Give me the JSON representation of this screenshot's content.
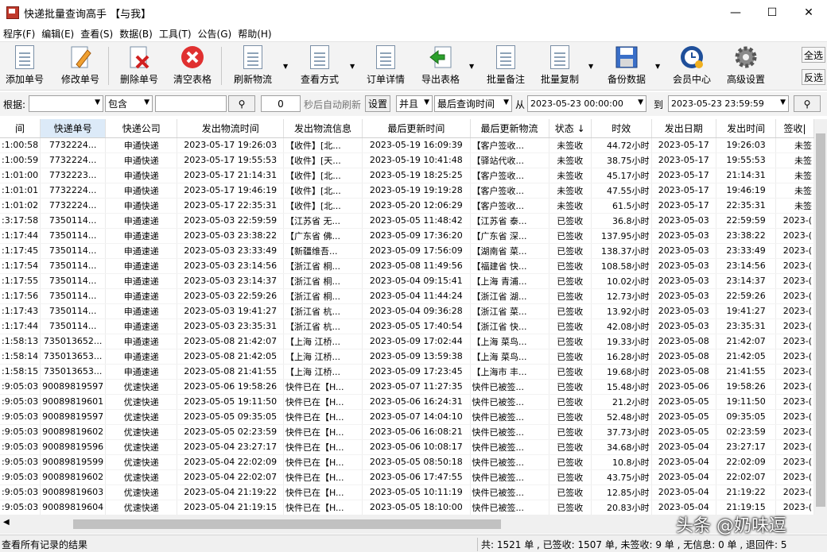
{
  "window": {
    "title": "快递批量查询高手 【与我】",
    "minimize": "—",
    "maximize": "☐",
    "close": "✕"
  },
  "menu": [
    "程序(F)",
    "编辑(E)",
    "查看(S)",
    "数据(B)",
    "工具(T)",
    "公告(G)",
    "帮助(H)"
  ],
  "toolbar": {
    "add": "添加单号",
    "edit": "修改单号",
    "delete": "删除单号",
    "clear": "清空表格",
    "refresh": "刷新物流",
    "view": "查看方式",
    "detail": "订单详情",
    "export": "导出表格",
    "batch_note": "批量备注",
    "batch_copy": "批量复制",
    "backup": "备份数据",
    "member": "会员中心",
    "advanced": "高级设置",
    "select_all": "全选",
    "invert": "反选"
  },
  "filter": {
    "based_on_label": "根据:",
    "based_on_value": "",
    "mode": "包含",
    "keyword": "",
    "seconds": "0",
    "auto_refresh_label": "秒后自动刷新",
    "settings": "设置",
    "logic": "并且",
    "time_field": "最后查询时间",
    "from_label": "从",
    "from": "2023-05-23 00:00:00",
    "to_label": "到",
    "to": "2023-05-23 23:59:59"
  },
  "columns": [
    "间",
    "快递单号",
    "快递公司",
    "发出物流时间",
    "发出物流信息",
    "最后更新时间",
    "最后更新物流",
    "状态 ↓",
    "时效",
    "发出日期",
    "发出时间",
    "签收|"
  ],
  "rows": [
    [
      ":1:00:58",
      "7732224...",
      "申通快递",
      "2023-05-17 19:26:03",
      "【收件】[北...",
      "2023-05-19 16:09:39",
      "【客户签收...",
      "未签收",
      "44.72小时",
      "2023-05-17",
      "19:26:03",
      "未签"
    ],
    [
      ":1:00:59",
      "7732224...",
      "申通快递",
      "2023-05-17 19:55:53",
      "【收件】[天...",
      "2023-05-19 10:41:48",
      "【驿站代收...",
      "未签收",
      "38.75小时",
      "2023-05-17",
      "19:55:53",
      "未签"
    ],
    [
      ":1:01:00",
      "7732223...",
      "申通快递",
      "2023-05-17 21:14:31",
      "【收件】[北...",
      "2023-05-19 18:25:25",
      "【客户签收...",
      "未签收",
      "45.17小时",
      "2023-05-17",
      "21:14:31",
      "未签"
    ],
    [
      ":1:01:01",
      "7732224...",
      "申通快递",
      "2023-05-17 19:46:19",
      "【收件】[北...",
      "2023-05-19 19:19:28",
      "【客户签收...",
      "未签收",
      "47.55小时",
      "2023-05-17",
      "19:46:19",
      "未签"
    ],
    [
      ":1:01:02",
      "7732224...",
      "申通快递",
      "2023-05-17 22:35:31",
      "【收件】[北...",
      "2023-05-20 12:06:29",
      "【客户签收...",
      "未签收",
      "61.5小时",
      "2023-05-17",
      "22:35:31",
      "未签"
    ],
    [
      ":3:17:58",
      "7350114...",
      "申通速递",
      "2023-05-03 22:59:59",
      "【江苏省 无...",
      "2023-05-05 11:48:42",
      "【江苏省 泰...",
      "已签收",
      "36.8小时",
      "2023-05-03",
      "22:59:59",
      "2023-("
    ],
    [
      ":1:17:44",
      "7350114...",
      "申通速递",
      "2023-05-03 23:38:22",
      "【广东省 佛...",
      "2023-05-09 17:36:20",
      "【广东省 深...",
      "已签收",
      "137.95小时",
      "2023-05-03",
      "23:38:22",
      "2023-("
    ],
    [
      ":1:17:45",
      "7350114...",
      "申通速递",
      "2023-05-03 23:33:49",
      "【新疆维吾...",
      "2023-05-09 17:56:09",
      "【湖南省 菜...",
      "已签收",
      "138.37小时",
      "2023-05-03",
      "23:33:49",
      "2023-("
    ],
    [
      ":1:17:54",
      "7350114...",
      "申通速递",
      "2023-05-03 23:14:56",
      "【浙江省 桐...",
      "2023-05-08 11:49:56",
      "【福建省 快...",
      "已签收",
      "108.58小时",
      "2023-05-03",
      "23:14:56",
      "2023-("
    ],
    [
      ":1:17:55",
      "7350114...",
      "申通速递",
      "2023-05-03 23:14:37",
      "【浙江省 桐...",
      "2023-05-04 09:15:41",
      "【上海 青浦...",
      "已签收",
      "10.02小时",
      "2023-05-03",
      "23:14:37",
      "2023-("
    ],
    [
      ":1:17:56",
      "7350114...",
      "申通速递",
      "2023-05-03 22:59:26",
      "【浙江省 桐...",
      "2023-05-04 11:44:24",
      "【浙江省 湖...",
      "已签收",
      "12.73小时",
      "2023-05-03",
      "22:59:26",
      "2023-("
    ],
    [
      ":1:17:43",
      "7350114...",
      "申通速递",
      "2023-05-03 19:41:27",
      "【浙江省 杭...",
      "2023-05-04 09:36:28",
      "【浙江省 菜...",
      "已签收",
      "13.92小时",
      "2023-05-03",
      "19:41:27",
      "2023-("
    ],
    [
      ":1:17:44",
      "7350114...",
      "申通速递",
      "2023-05-03 23:35:31",
      "【浙江省 杭...",
      "2023-05-05 17:40:54",
      "【浙江省 快...",
      "已签收",
      "42.08小时",
      "2023-05-03",
      "23:35:31",
      "2023-("
    ],
    [
      ":1:58:13",
      "735013652...",
      "申通速递",
      "2023-05-08 21:42:07",
      "【上海 江桥...",
      "2023-05-09 17:02:44",
      "【上海 菜鸟...",
      "已签收",
      "19.33小时",
      "2023-05-08",
      "21:42:07",
      "2023-("
    ],
    [
      ":1:58:14",
      "735013653...",
      "申通速递",
      "2023-05-08 21:42:05",
      "【上海 江桥...",
      "2023-05-09 13:59:38",
      "【上海 菜鸟...",
      "已签收",
      "16.28小时",
      "2023-05-08",
      "21:42:05",
      "2023-("
    ],
    [
      ":1:58:15",
      "735013653...",
      "申通速递",
      "2023-05-08 21:41:55",
      "【上海 江桥...",
      "2023-05-09 17:23:45",
      "【上海市 丰...",
      "已签收",
      "19.68小时",
      "2023-05-08",
      "21:41:55",
      "2023-("
    ],
    [
      ":9:05:03",
      "90089819597",
      "优速快递",
      "2023-05-06 19:58:26",
      "快件已在【H...",
      "2023-05-07 11:27:35",
      "快件已被签...",
      "已签收",
      "15.48小时",
      "2023-05-06",
      "19:58:26",
      "2023-("
    ],
    [
      ":9:05:03",
      "90089819601",
      "优速快递",
      "2023-05-05 19:11:50",
      "快件已在【H...",
      "2023-05-06 16:24:31",
      "快件已被签...",
      "已签收",
      "21.2小时",
      "2023-05-05",
      "19:11:50",
      "2023-("
    ],
    [
      ":9:05:03",
      "90089819597",
      "优速快递",
      "2023-05-05 09:35:05",
      "快件已在【H...",
      "2023-05-07 14:04:10",
      "快件已被签...",
      "已签收",
      "52.48小时",
      "2023-05-05",
      "09:35:05",
      "2023-("
    ],
    [
      ":9:05:03",
      "90089819602",
      "优速快递",
      "2023-05-05 02:23:59",
      "快件已在【H...",
      "2023-05-06 16:08:21",
      "快件已被签...",
      "已签收",
      "37.73小时",
      "2023-05-05",
      "02:23:59",
      "2023-("
    ],
    [
      ":9:05:03",
      "90089819596",
      "优速快递",
      "2023-05-04 23:27:17",
      "快件已在【H...",
      "2023-05-06 10:08:17",
      "快件已被签...",
      "已签收",
      "34.68小时",
      "2023-05-04",
      "23:27:17",
      "2023-("
    ],
    [
      ":9:05:03",
      "90089819599",
      "优速快递",
      "2023-05-04 22:02:09",
      "快件已在【H...",
      "2023-05-05 08:50:18",
      "快件已被签...",
      "已签收",
      "10.8小时",
      "2023-05-04",
      "22:02:09",
      "2023-("
    ],
    [
      ":9:05:03",
      "90089819602",
      "优速快递",
      "2023-05-04 22:02:07",
      "快件已在【H...",
      "2023-05-06 17:47:55",
      "快件已被签...",
      "已签收",
      "43.75小时",
      "2023-05-04",
      "22:02:07",
      "2023-("
    ],
    [
      ":9:05:03",
      "90089819603",
      "优速快递",
      "2023-05-04 21:19:22",
      "快件已在【H...",
      "2023-05-05 10:11:19",
      "快件已被签...",
      "已签收",
      "12.85小时",
      "2023-05-04",
      "21:19:22",
      "2023-("
    ],
    [
      ":9:05:03",
      "90089819604",
      "优速快递",
      "2023-05-04 21:19:15",
      "快件已在【H...",
      "2023-05-05 18:10:00",
      "快件已被签...",
      "已签收",
      "20.83小时",
      "2023-05-04",
      "21:19:15",
      "2023-("
    ]
  ],
  "status": {
    "left": "查看所有记录的结果",
    "right": "共: 1521 单 , 已签收: 1507 单, 未签收: 9 单 , 无信息: 0 单 , 退回件: 5"
  },
  "watermark": "头条 @奶味逗",
  "colors": {
    "accent": "#2d6fd1",
    "selected_header": "#dceaf8"
  }
}
